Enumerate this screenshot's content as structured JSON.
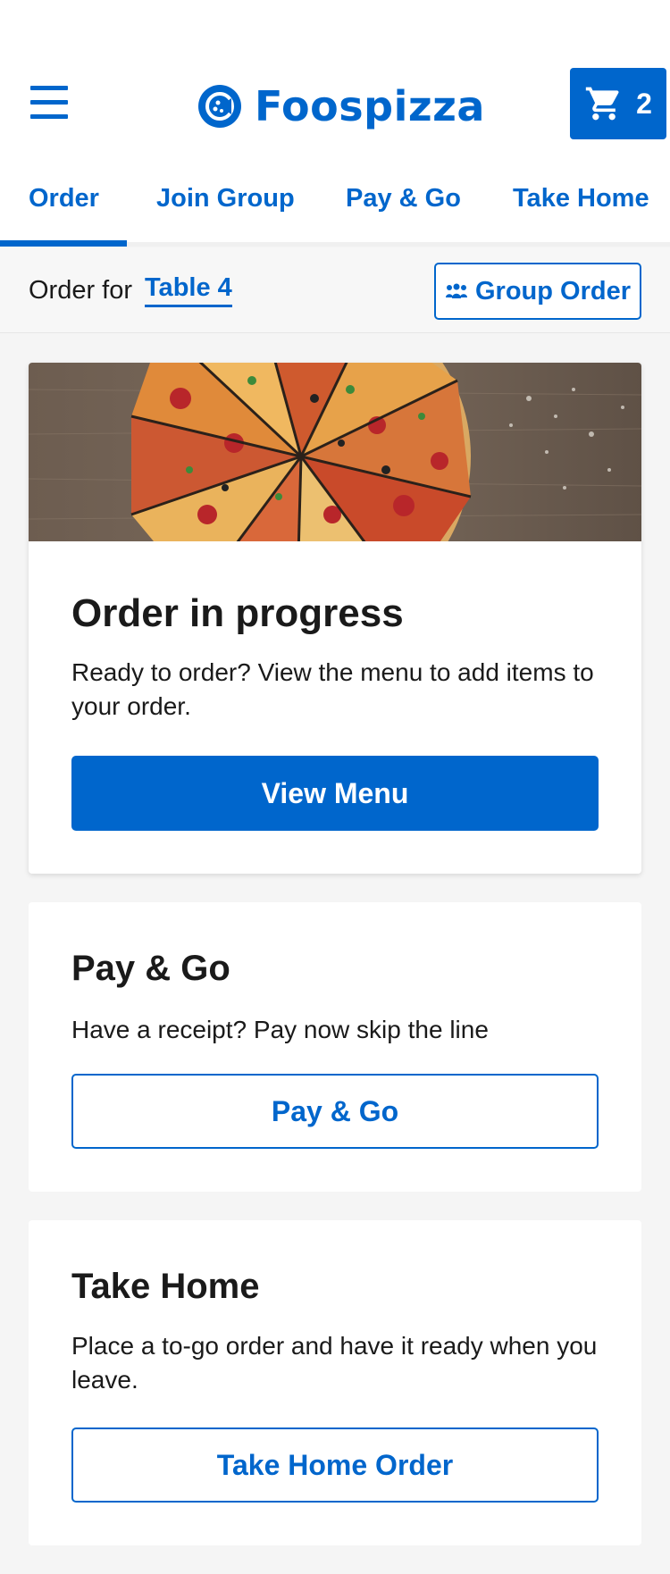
{
  "app": {
    "brand_name": "Foospizza",
    "cart_count": "2",
    "accent_color": "#0066cc"
  },
  "icons": {
    "menu": "hamburger-menu-icon",
    "logo": "pizza-logo-icon",
    "cart": "shopping-cart-icon",
    "group": "group-people-icon"
  },
  "tabs": [
    {
      "label": "Order",
      "active": true
    },
    {
      "label": "Join Group",
      "active": false
    },
    {
      "label": "Pay & Go",
      "active": false
    },
    {
      "label": "Take Home",
      "active": false
    }
  ],
  "order_bar": {
    "label": "Order for",
    "table": "Table 4",
    "group_button": "Group Order"
  },
  "cards": {
    "order": {
      "title": "Order in progress",
      "description": "Ready to order? View the menu to add items to your order.",
      "button": "View Menu"
    },
    "pay": {
      "title": "Pay & Go",
      "description": "Have a receipt? Pay now skip the line",
      "button": "Pay & Go"
    },
    "take_home": {
      "title": "Take Home",
      "description": "Place a to-go order and have it ready when you leave.",
      "button": "Take Home Order"
    }
  }
}
